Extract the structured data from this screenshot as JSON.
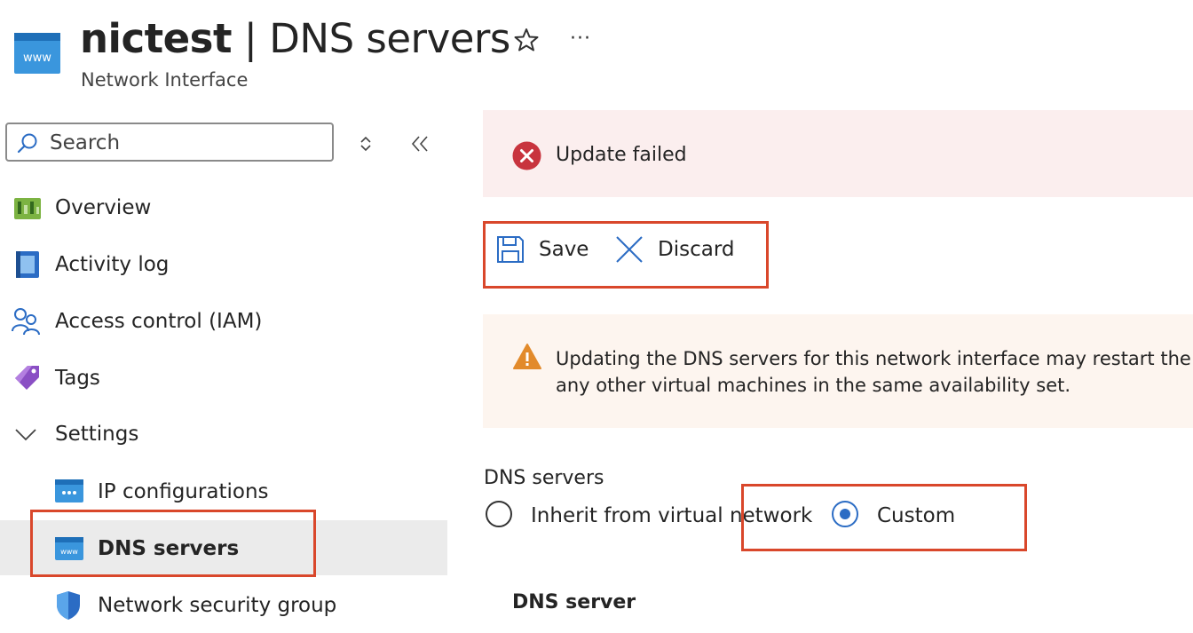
{
  "header": {
    "resource_name": "nictest",
    "separator": " | ",
    "blade_title": "DNS servers",
    "subtitle": "Network Interface",
    "more_label": "···",
    "resource_icon_text": "www"
  },
  "sidebar": {
    "search": {
      "placeholder": "Search"
    },
    "items": [
      {
        "label": "Overview",
        "icon": "overview-icon"
      },
      {
        "label": "Activity log",
        "icon": "activity-log-icon"
      },
      {
        "label": "Access control (IAM)",
        "icon": "iam-icon"
      },
      {
        "label": "Tags",
        "icon": "tag-icon"
      },
      {
        "label": "Settings",
        "icon": "chevron-down-icon",
        "expanded": true
      },
      {
        "label": "IP configurations",
        "icon": "ip-config-icon"
      },
      {
        "label": "DNS servers",
        "icon": "dns-icon",
        "selected": true
      },
      {
        "label": "Network security group",
        "icon": "shield-icon"
      }
    ]
  },
  "error_banner": {
    "text": "Update failed",
    "icon": "error-icon"
  },
  "toolbar": {
    "save_label": "Save",
    "discard_label": "Discard"
  },
  "warning_banner": {
    "line1": "Updating the DNS servers for this network interface may restart the",
    "line2": "any other virtual machines in the same availability set.",
    "icon": "warning-icon"
  },
  "dns": {
    "label": "DNS servers",
    "options": [
      {
        "label": "Inherit from virtual network",
        "selected": false
      },
      {
        "label": "Custom",
        "selected": true
      }
    ],
    "server_heading": "DNS server"
  },
  "colors": {
    "accent": "#2b6cc4",
    "error": "#c8343e",
    "warning": "#e28a2b",
    "highlight": "#d9472b",
    "selected_bg": "#ebebeb"
  }
}
